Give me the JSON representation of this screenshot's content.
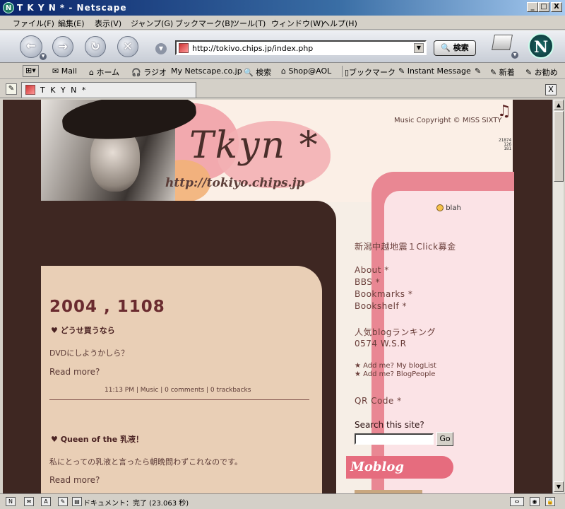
{
  "window": {
    "title": "T K Y N * - Netscape",
    "minimize": "_",
    "maximize": "□",
    "close": "X",
    "app_glyph": "N"
  },
  "menu": [
    "ファイル(F)",
    "編集(E)",
    "表示(V)",
    "ジャンプ(G)",
    "ブックマーク(B)",
    "ツール(T)",
    "ウィンドウ(W)",
    "ヘルプ(H)"
  ],
  "nav": {
    "url": "http://tokivo.chips.jp/index.php",
    "search_label": "🔍 検索",
    "netscape_glyph": "N"
  },
  "personal_toolbar": [
    {
      "label": "✉ Mail"
    },
    {
      "label": "⌂ ホーム"
    },
    {
      "label": "🎧 ラジオ"
    },
    {
      "label": "My Netscape.co.jp"
    },
    {
      "label": "🔍 検索"
    },
    {
      "label": "⌂ Shop@AOL"
    },
    {
      "label": "▯ブックマーク"
    },
    {
      "label": "✎ Instant Message"
    },
    {
      "label": "✎"
    },
    {
      "label": "✎ 新着"
    },
    {
      "label": "✎ お勧め"
    }
  ],
  "tab": {
    "label": "T K Y N *",
    "close": "X"
  },
  "site": {
    "logo": "Tkyn *",
    "logo_url": "http://tokiyo.chips.jp",
    "copyright": "Music Copyright © MISS SIXTY",
    "note_glyph": "♫",
    "counter": [
      "21874",
      "126",
      "181"
    ],
    "blah": "blah"
  },
  "entries": {
    "date": "2004 , 1108",
    "e1_title": "♥ どうせ買うなら",
    "e1_body": "DVDにしようかしら？",
    "e1_readmore": "Read more?",
    "e1_meta": "11:13 PM | Music | 0 comments | 0 trackbacks",
    "e2_title": "♥ Queen of the 乳液！",
    "e2_body": "私にとっての乳液と言ったら朝晩問わずこれなのです。",
    "e2_readmore": "Read more?"
  },
  "sidebar": {
    "quake": "新潟中越地震１Click募金",
    "links": [
      "About *",
      "BBS *",
      "Bookmarks *",
      "Bookshelf *"
    ],
    "ranking": [
      "人気blogランキング",
      "0574 W.S.R"
    ],
    "addme": [
      "★ Add me? My blogList",
      "★ Add me? BlogPeople"
    ],
    "qr": "QR Code *",
    "search_label": "Search this site?",
    "go": "Go",
    "moblog": "Moblog"
  },
  "status": {
    "text": "ドキュメント：完了 (23.063 秒)"
  }
}
